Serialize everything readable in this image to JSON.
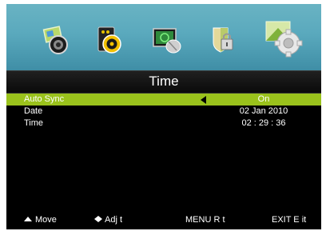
{
  "menu": {
    "title": "Time",
    "accent_color": "#9ac21c",
    "top_icons": [
      {
        "name": "picture-icon"
      },
      {
        "name": "sound-icon"
      },
      {
        "name": "channel-icon"
      },
      {
        "name": "lock-icon"
      },
      {
        "name": "setup-gear-icon",
        "selected": true
      }
    ]
  },
  "rows": [
    {
      "label": "Auto Sync",
      "value": "On"
    },
    {
      "label": "Date",
      "value": "02  Jan  2010"
    },
    {
      "label": "Time",
      "value": "02 : 29 : 36"
    }
  ],
  "footer": {
    "move": "Move",
    "adjust": "Adj   t",
    "menu": "MENU  R  t",
    "exit": "EXIT  E  it"
  }
}
